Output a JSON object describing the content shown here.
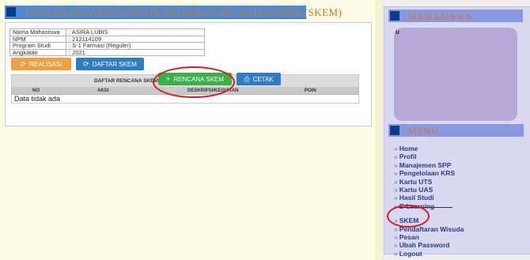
{
  "header": {
    "title": "SATUAN KEGIATAN EKSTRAKURIKULER MAHASISWA (SKEM)"
  },
  "student": [
    {
      "label": "Nama Mahasiswa",
      "value": ": ASIRA LUBIS"
    },
    {
      "label": "NPM",
      "value": ": 212114109"
    },
    {
      "label": "Program Studi",
      "value": ": S-1 Farmasi (Reguler)"
    },
    {
      "label": "Angkatan",
      "value": ": 2021"
    }
  ],
  "buttons": {
    "realisasi": "REALISASI",
    "daftar_skem": "DAFTAR SKEM",
    "rencana_skem": "RENCANA SKEM",
    "cetak": "CETAK"
  },
  "table": {
    "caption": "DAFTAR RENCANA SKEM",
    "columns": [
      "NO",
      "AKSI",
      "DESKRIPSI/KEGIATAN",
      "POIN"
    ],
    "empty": "Data tidak ada"
  },
  "sidebar": {
    "profile_title": "MAHASISWA",
    "profile_initial": "U",
    "menu_title": "MENU",
    "items": [
      "Home",
      "Profil",
      "Manajemen SPP",
      "Pengelolaan KRS",
      "Kartu UTS",
      "Kartu UAS",
      "Hasil Studi",
      "E-Learning"
    ],
    "items2": [
      "SKEM",
      "Pendaftaran Wisuda",
      "Pesan",
      "Ubah Password",
      "Logout"
    ]
  },
  "colors": {
    "accent": "#4a8bd6",
    "highlight": "#e0171d",
    "success": "#3cae4a",
    "warning": "#f0a040"
  }
}
